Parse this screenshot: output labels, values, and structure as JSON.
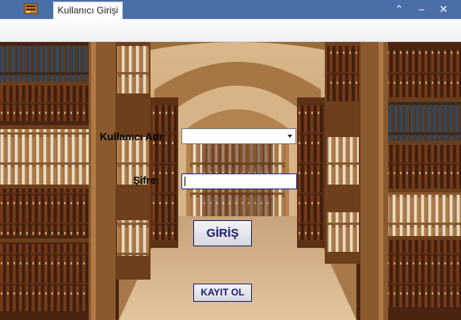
{
  "window": {
    "tab_title": "Kullanıcı Girişi",
    "controls": {
      "minimize": "–",
      "maximize": "⌃",
      "close": "✕"
    }
  },
  "login": {
    "username_label": "Kullanıcı Adı:",
    "username_value": "",
    "password_label": "Şifre:",
    "password_value": "",
    "login_button": "GİRİŞ",
    "register_button": "KAYIT OL"
  },
  "icons": {
    "app": "app-icon",
    "dropdown": "chevron-down-icon"
  },
  "colors": {
    "titlebar": "#4a6ea8",
    "button_text": "#1a1f6e"
  }
}
